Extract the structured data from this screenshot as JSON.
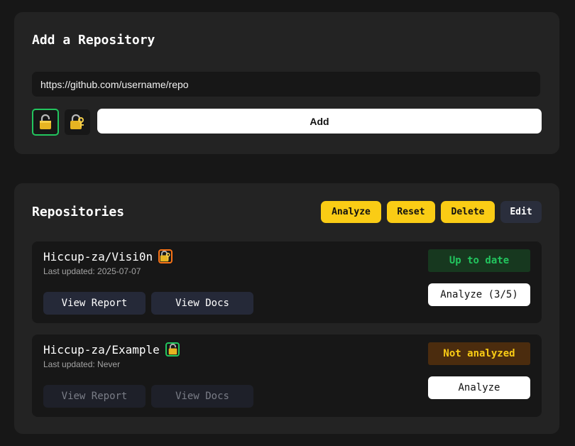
{
  "add_section": {
    "title": "Add a Repository",
    "url_value": "https://github.com/username/repo",
    "public_icon": "unlocked-padlock-icon",
    "private_icon": "locked-padlock-with-key-icon",
    "add_label": "Add"
  },
  "repos_section": {
    "title": "Repositories",
    "actions": {
      "analyze": "Analyze",
      "reset": "Reset",
      "delete": "Delete",
      "edit": "Edit"
    },
    "repos": [
      {
        "name": "Hiccup-za/Visi0n",
        "visibility_icon": "locked-padlock-with-key-icon",
        "updated": "Last updated: 2025-07-07",
        "view_report": "View Report",
        "view_docs": "View Docs",
        "status": "Up to date",
        "analyze": "Analyze (3/5)"
      },
      {
        "name": "Hiccup-za/Example",
        "visibility_icon": "unlocked-padlock-icon",
        "updated": "Last updated: Never",
        "view_report": "View Report",
        "view_docs": "View Docs",
        "status": "Not analyzed",
        "analyze": "Analyze"
      }
    ]
  },
  "colors": {
    "background": "#171717",
    "card": "#232323",
    "accent_yellow": "#facc15",
    "success_green": "#22c55e",
    "private_orange": "#f97316"
  }
}
